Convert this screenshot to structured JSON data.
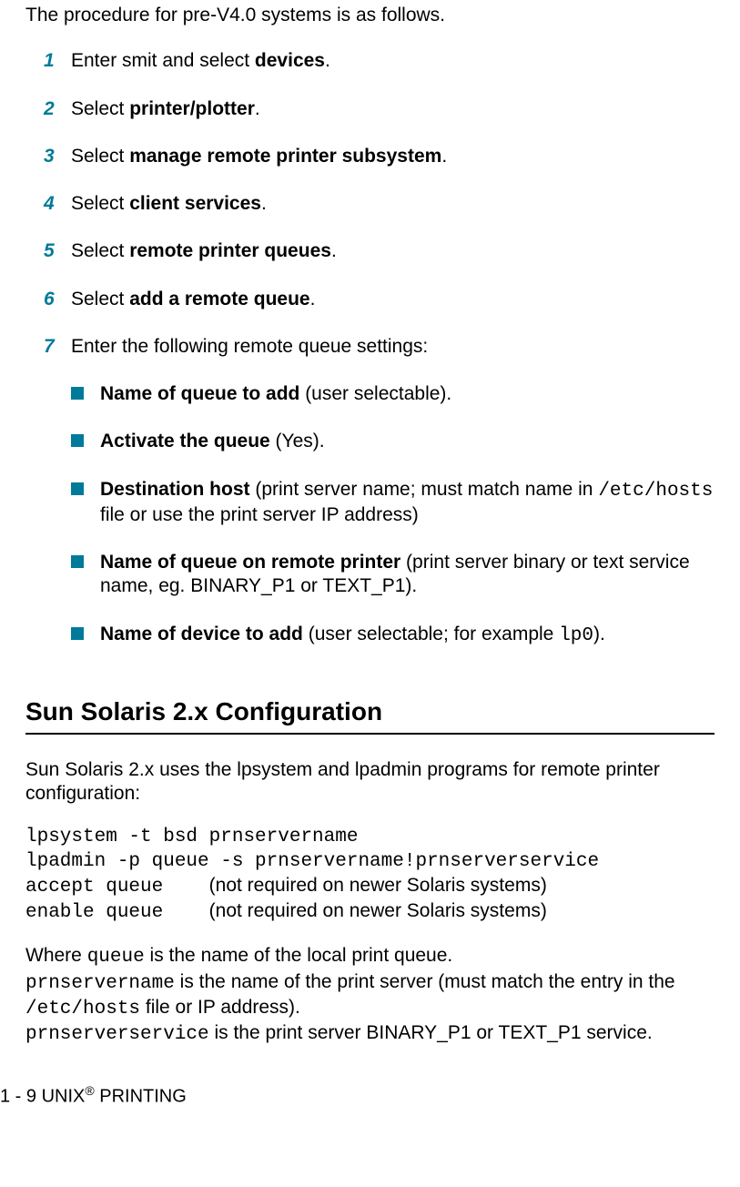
{
  "intro": "The procedure for pre-V4.0 systems is as follows.",
  "steps": [
    {
      "num": "1",
      "pre": "Enter smit and select ",
      "bold": "devices",
      "post": "."
    },
    {
      "num": "2",
      "pre": "Select ",
      "bold": "printer/plotter",
      "post": "."
    },
    {
      "num": "3",
      "pre": "Select ",
      "bold": "manage remote printer subsystem",
      "post": "."
    },
    {
      "num": "4",
      "pre": "Select ",
      "bold": "client services",
      "post": "."
    },
    {
      "num": "5",
      "pre": "Select ",
      "bold": "remote printer queues",
      "post": "."
    },
    {
      "num": "6",
      "pre": "Select ",
      "bold": "add a remote queue",
      "post": "."
    },
    {
      "num": "7",
      "pre": "Enter the following remote queue settings:",
      "bold": "",
      "post": ""
    }
  ],
  "bullets": [
    {
      "bold": "Name of queue to add",
      "post": " (user selectable)."
    },
    {
      "bold": "Activate the queue",
      "post": " (Yes)."
    },
    {
      "bold": "Destination host",
      "post_a": " (print server name; must match name in ",
      "mono": "/etc/hosts",
      "post_b": " file or use the print server IP address)"
    },
    {
      "bold": "Name of queue on remote printer",
      "post": " (print server binary or text service name, eg. BINARY_P1 or TEXT_P1)."
    },
    {
      "bold": "Name of device to add",
      "post_a": " (user selectable; for example ",
      "mono": "lp0",
      "post_b": ")."
    }
  ],
  "section_heading": "Sun Solaris 2.x Configuration",
  "solaris_intro": "Sun Solaris 2.x uses the lpsystem and lpadmin programs for remote printer configuration:",
  "code": {
    "l1": "lpsystem -t bsd prnservername",
    "l2": "lpadmin -p queue -s prnservername!prnserverservice",
    "l3a": "accept queue",
    "l3b": "(not required on newer Solaris systems)",
    "l4a": "enable queue",
    "l4b": "(not required on newer Solaris systems)"
  },
  "explain": {
    "t1": "Where ",
    "m1": "queue",
    "t2": " is the name of the local print queue.",
    "m2": "prnservername",
    "t3": " is the name of the print server (must match the entry in the ",
    "m3": "/etc/hosts",
    "t4": " file or IP address).",
    "m4": "prnserverservice",
    "t5": " is the print server BINARY_P1 or TEXT_P1 service."
  },
  "footer": {
    "a": "1 - 9 UNIX",
    "sup": "®",
    "b": " PRINTING"
  }
}
